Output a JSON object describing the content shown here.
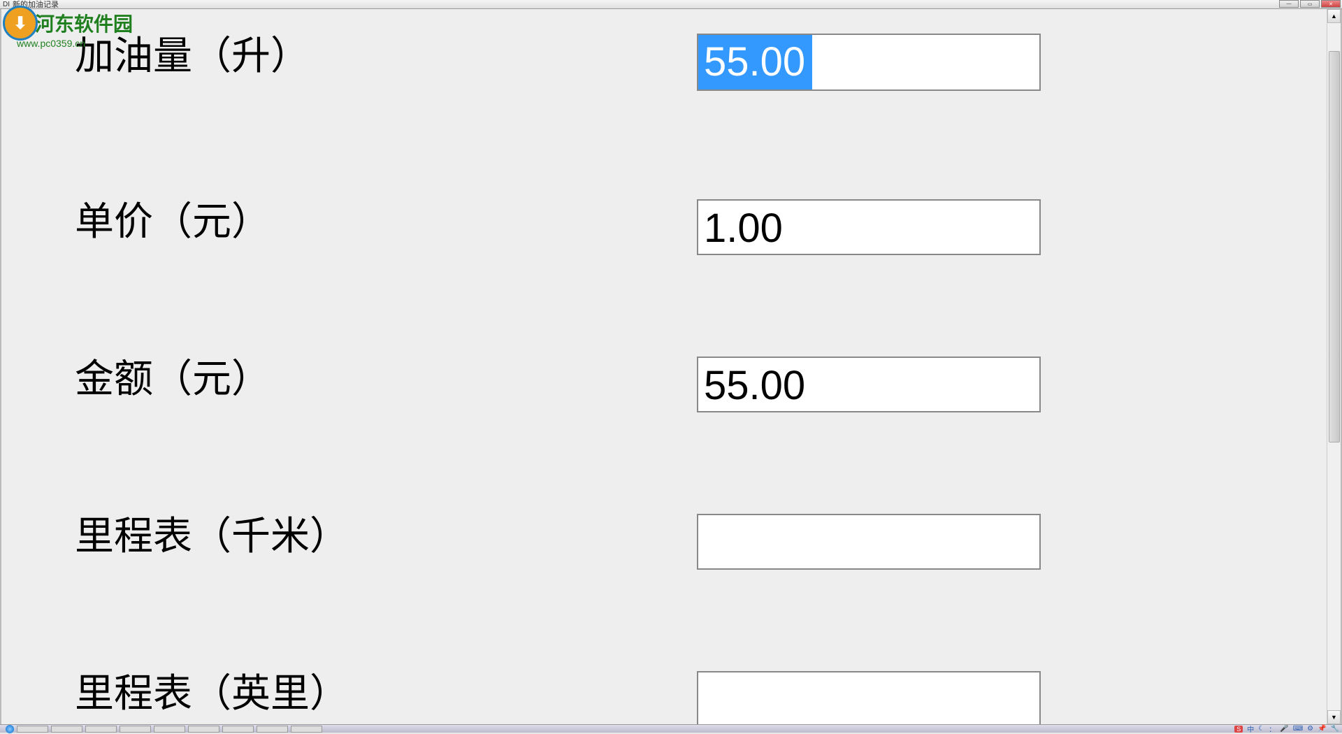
{
  "window": {
    "icon_prefix": "DI",
    "title": "新的加油记录"
  },
  "watermark": {
    "text": "河东软件园",
    "url": "www.pc0359.cn"
  },
  "form": {
    "rows": [
      {
        "label": "加油量（升）",
        "value": "55.00",
        "selected": true
      },
      {
        "label": "单价（元）",
        "value": "1.00",
        "selected": false
      },
      {
        "label": "金额（元）",
        "value": "55.00",
        "selected": false
      },
      {
        "label": "里程表（千米）",
        "value": "",
        "selected": false
      },
      {
        "label": "里程表（英里）",
        "value": "",
        "selected": false
      }
    ]
  },
  "tray": {
    "ime": "S",
    "ime_text": "中",
    "icons": [
      "☾",
      "：",
      "🎤",
      "⌨",
      "⚙",
      "📌",
      "🔧"
    ]
  }
}
